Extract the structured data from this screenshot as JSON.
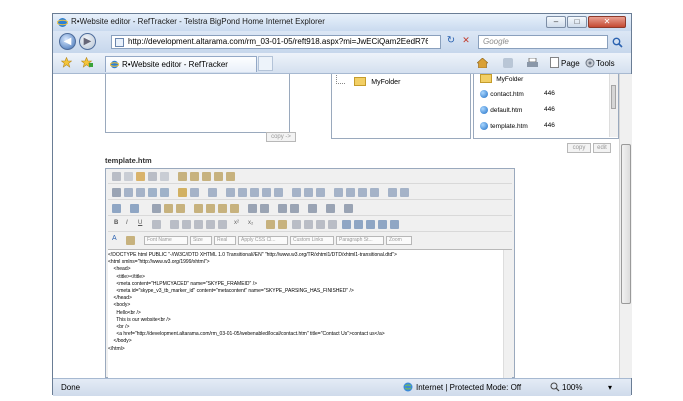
{
  "window": {
    "title": "R•Website editor - RefTracker - Telstra BigPond Home Internet Explorer",
    "minimize": "–",
    "maximize": "□",
    "close": "✕"
  },
  "address": {
    "url": "http://development.altarama.com/rm_03-01-05/reft918.aspx?mi=JwECiQam2EedR76QWL8Q",
    "search_placeholder": "Google",
    "refresh": "↻",
    "stop": "✕"
  },
  "toolbar": {
    "tab_label": "R•Website editor - RefTracker",
    "page_label": "Page",
    "tools_label": "Tools"
  },
  "tree": {
    "folder": "MyFolder"
  },
  "files": {
    "folder": "MyFolder",
    "items": [
      {
        "name": "contact.htm",
        "size": "446"
      },
      {
        "name": "default.htm",
        "size": "446"
      },
      {
        "name": "template.htm",
        "size": "446"
      }
    ]
  },
  "buttons": {
    "copy_arrow": "copy ->",
    "copy": "copy",
    "edit": "edit"
  },
  "editor": {
    "heading": "template.htm",
    "font_name": "Font Name",
    "size": "Size",
    "real": "Real",
    "apply_css": "Apply CSS Cl...",
    "custom_links": "Custom Links",
    "paragraph": "Paragraph St...",
    "zoom": "Zoom",
    "source": "<!DOCTYPE html PUBLIC \"-//W3C//DTD XHTML 1.0 Transitional//EN\" \"http://www.w3.org/TR/xhtml1/DTD/xhtml1-transitional.dtd\">\n<html xmlns=\"http://www.w3.org/1999/xhtml\">\n    <head>\n      <title></title>\n      <meta content=\"HLPMCYACED\" name=\"SKYPE_FRAMEID\" />\n      <meta id=\"skype_v3_tb_marker_id\" content=\"metacontent\" name=\"SKYPE_PARSING_HAS_FINISHED\" />\n    </head>\n    <body>\n      Hello<br />\n      This is our website<br />\n      <br />\n      <a href=\"http://development.altarama.com/rm_03-01-05/webenabled/local/contact.htm\" title=\"Contact Us\">contact us</a>\n    </body>\n</html>"
  },
  "status": {
    "left": "Done",
    "zone": "Internet | Protected Mode: Off",
    "zoom": "100%"
  },
  "colors": {
    "accent": "#3d6fb4",
    "close": "#c44a33"
  }
}
